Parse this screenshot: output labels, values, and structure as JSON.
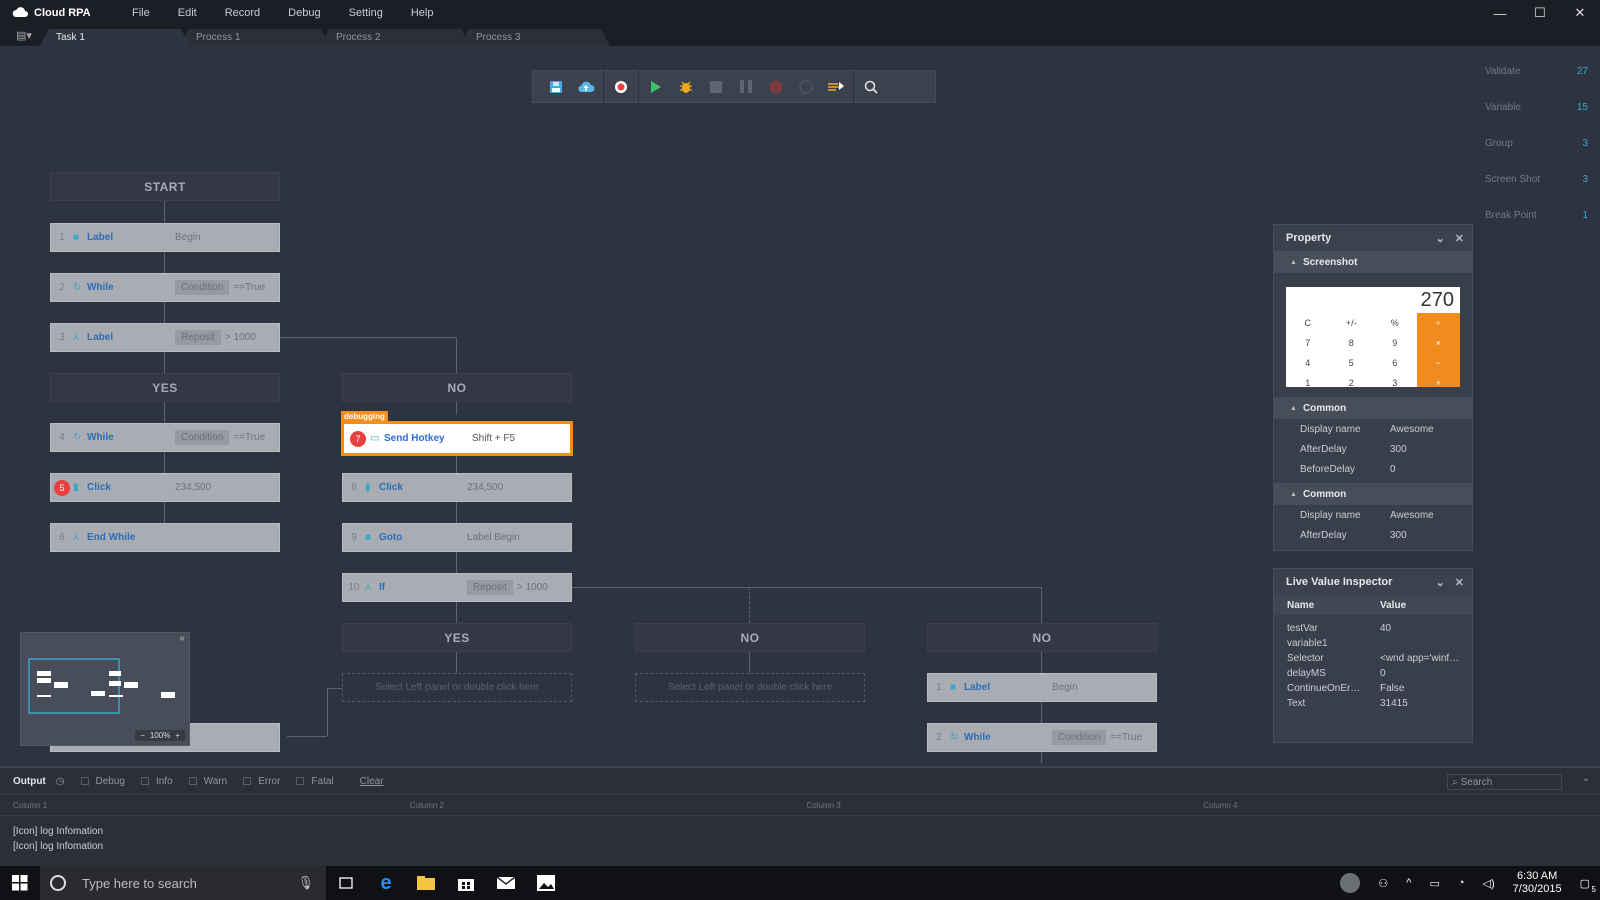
{
  "app": {
    "title": "Cloud RPA",
    "menu": [
      "File",
      "Edit",
      "Record",
      "Debug",
      "Setting",
      "Help"
    ]
  },
  "tabs": [
    "Task 1",
    "Process 1",
    "Process 2",
    "Process 3"
  ],
  "stats": [
    {
      "label": "Validate",
      "value": "27"
    },
    {
      "label": "Variable",
      "value": "15"
    },
    {
      "label": "Group",
      "value": "3"
    },
    {
      "label": "Screen Shot",
      "value": "3"
    },
    {
      "label": "Break Point",
      "value": "1"
    }
  ],
  "flow": {
    "start": "START",
    "yes": "YES",
    "no": "NO",
    "debugging": "debugging",
    "placeholder": "Select Left panel or double click here",
    "n1": {
      "num": "1",
      "name": "Label",
      "arg": "Begin"
    },
    "n2": {
      "num": "2",
      "name": "While",
      "pill": "Condition",
      "arg": "==True"
    },
    "n3": {
      "num": "3",
      "name": "Label",
      "pill": "Reposit",
      "arg": "> 1000"
    },
    "n4": {
      "num": "4",
      "name": "While",
      "pill": "Condition",
      "arg": "==True"
    },
    "n5": {
      "num": "5",
      "name": "Click",
      "arg": "234,500"
    },
    "n6": {
      "num": "6",
      "name": "End While"
    },
    "n7": {
      "num": "7",
      "name": "Send Hotkey",
      "arg": "Shift + F5"
    },
    "n8": {
      "num": "8",
      "name": "Click",
      "arg": "234,500"
    },
    "n9": {
      "num": "9",
      "name": "Goto",
      "arg": "Label Begin"
    },
    "n10": {
      "num": "10",
      "name": "If",
      "pill": "Reposit",
      "arg": "> 1000"
    },
    "r1": {
      "num": "1",
      "name": "Label",
      "arg": "Begin"
    },
    "r2": {
      "num": "2",
      "name": "While",
      "pill": "Condition",
      "arg": "==True"
    }
  },
  "property": {
    "title": "Property",
    "screenshot": "Screenshot",
    "calc_display": "270",
    "calc_rows": [
      [
        "C",
        "+/-",
        "%",
        "÷"
      ],
      [
        "7",
        "8",
        "9",
        "×"
      ],
      [
        "4",
        "5",
        "6",
        "−"
      ],
      [
        "1",
        "2",
        "3",
        "+"
      ]
    ],
    "sections": [
      {
        "title": "Common",
        "rows": [
          [
            "Display name",
            "Awesome"
          ],
          [
            "AfterDelay",
            "300"
          ],
          [
            "BeforeDelay",
            "0"
          ]
        ]
      },
      {
        "title": "Common",
        "rows": [
          [
            "Display name",
            "Awesome"
          ],
          [
            "AfterDelay",
            "300"
          ]
        ]
      }
    ]
  },
  "inspector": {
    "title": "Live Value Inspector",
    "col_name": "Name",
    "col_value": "Value",
    "rows": [
      [
        "testVar",
        "40"
      ],
      [
        "variable1",
        ""
      ],
      [
        "Selector",
        "<wnd app='winf…"
      ],
      [
        "delayMS",
        "0"
      ],
      [
        "ContinueOnEr…",
        "False"
      ],
      [
        "Text",
        "31415"
      ]
    ]
  },
  "minimap": {
    "zoom": "100%"
  },
  "output": {
    "title": "Output",
    "filters": [
      "Debug",
      "Info",
      "Warn",
      "Error",
      "Fatal"
    ],
    "clear": "Clear",
    "search_placeholder": "Search",
    "columns": [
      "Column 1",
      "Column 2",
      "Column 3",
      "Column 4"
    ],
    "logs": [
      "[Icon] log Infomation",
      "[Icon] log Infomation"
    ]
  },
  "taskbar": {
    "search": "Type here to search",
    "time": "6:30 AM",
    "date": "7/30/2015",
    "notif": "5"
  },
  "colors": {
    "accent": "#38a8c5",
    "debug": "#f28e1d",
    "breakpoint": "#e84040"
  }
}
